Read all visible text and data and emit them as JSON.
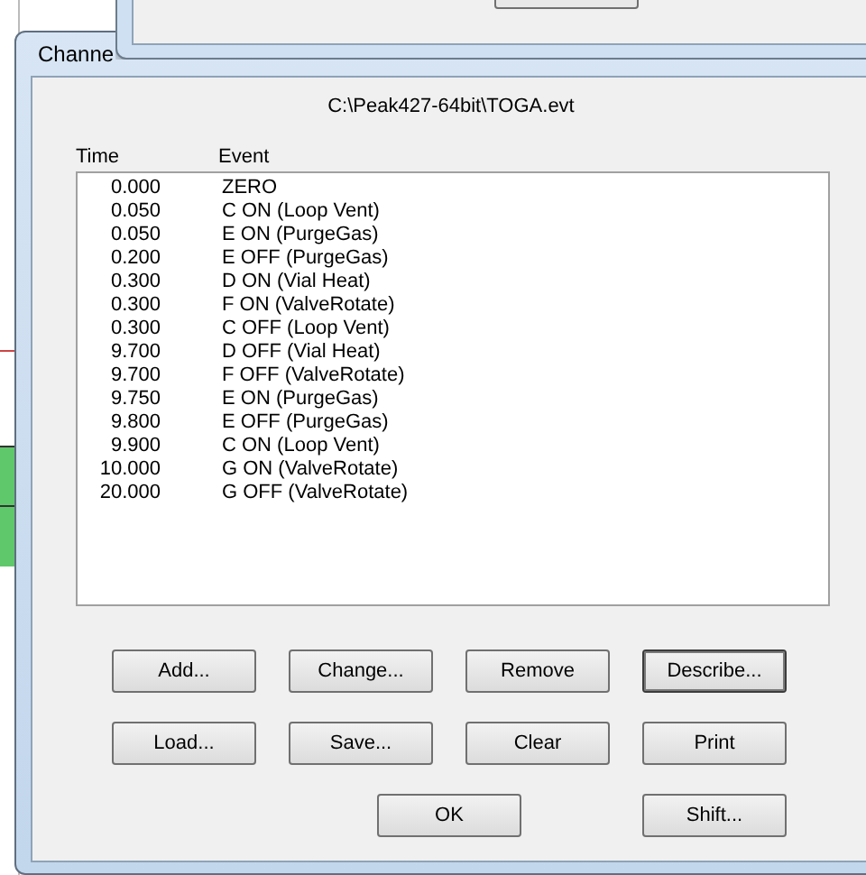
{
  "window": {
    "title": "Channe"
  },
  "file_path": "C:\\Peak427-64bit\\TOGA.evt",
  "table": {
    "columns": [
      "Time",
      "Event"
    ],
    "rows": [
      {
        "time": "0.000",
        "event": "ZERO"
      },
      {
        "time": "0.050",
        "event": "C ON (Loop Vent)"
      },
      {
        "time": "0.050",
        "event": "E ON (PurgeGas)"
      },
      {
        "time": "0.200",
        "event": "E OFF (PurgeGas)"
      },
      {
        "time": "0.300",
        "event": "D ON (Vial Heat)"
      },
      {
        "time": "0.300",
        "event": "F ON (ValveRotate)"
      },
      {
        "time": "0.300",
        "event": "C OFF (Loop Vent)"
      },
      {
        "time": "9.700",
        "event": "D OFF (Vial Heat)"
      },
      {
        "time": "9.700",
        "event": "F OFF (ValveRotate)"
      },
      {
        "time": "9.750",
        "event": "E ON (PurgeGas)"
      },
      {
        "time": "9.800",
        "event": "E OFF (PurgeGas)"
      },
      {
        "time": "9.900",
        "event": "C ON (Loop Vent)"
      },
      {
        "time": "10.000",
        "event": "G ON (ValveRotate)"
      },
      {
        "time": "20.000",
        "event": "G OFF (ValveRotate)"
      }
    ]
  },
  "buttons": [
    {
      "label": "Add...",
      "default": false
    },
    {
      "label": "Change...",
      "default": false
    },
    {
      "label": "Remove",
      "default": false
    },
    {
      "label": "Describe...",
      "default": true
    },
    {
      "label": "Load...",
      "default": false
    },
    {
      "label": "Save...",
      "default": false
    },
    {
      "label": "Clear",
      "default": false
    },
    {
      "label": "Print",
      "default": false
    },
    {
      "label": "OK",
      "default": false
    },
    {
      "label": "Shift...",
      "default": false
    }
  ]
}
